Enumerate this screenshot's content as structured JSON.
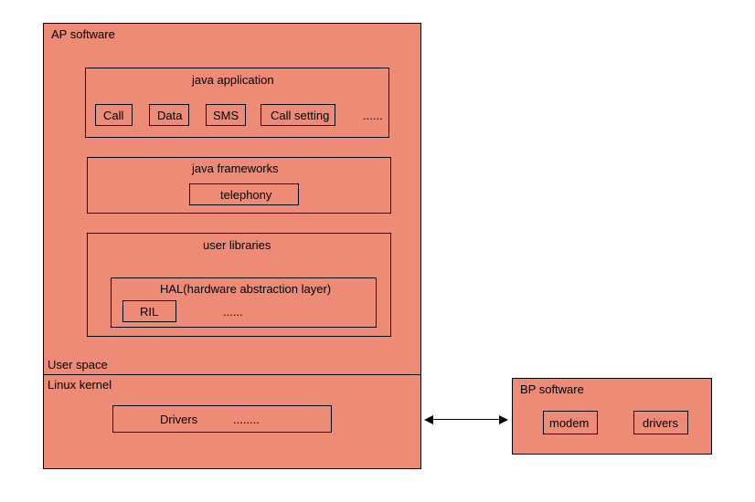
{
  "ap_software": {
    "title": "AP software",
    "user_space": "User space",
    "linux_kernel": "Linux kernel",
    "java_app": {
      "title": "java application",
      "items": [
        "Call",
        "Data",
        "SMS",
        "Call setting"
      ],
      "more": "......"
    },
    "java_fw": {
      "title": "java frameworks",
      "item": "telephony"
    },
    "user_lib": {
      "title": "user libraries",
      "hal": {
        "title": "HAL(hardware abstraction layer)",
        "item": "RIL",
        "more": "......"
      }
    },
    "drivers": {
      "label": "Drivers",
      "more": "........"
    }
  },
  "bp_software": {
    "title": "BP software",
    "items": [
      "modem",
      "drivers"
    ]
  }
}
